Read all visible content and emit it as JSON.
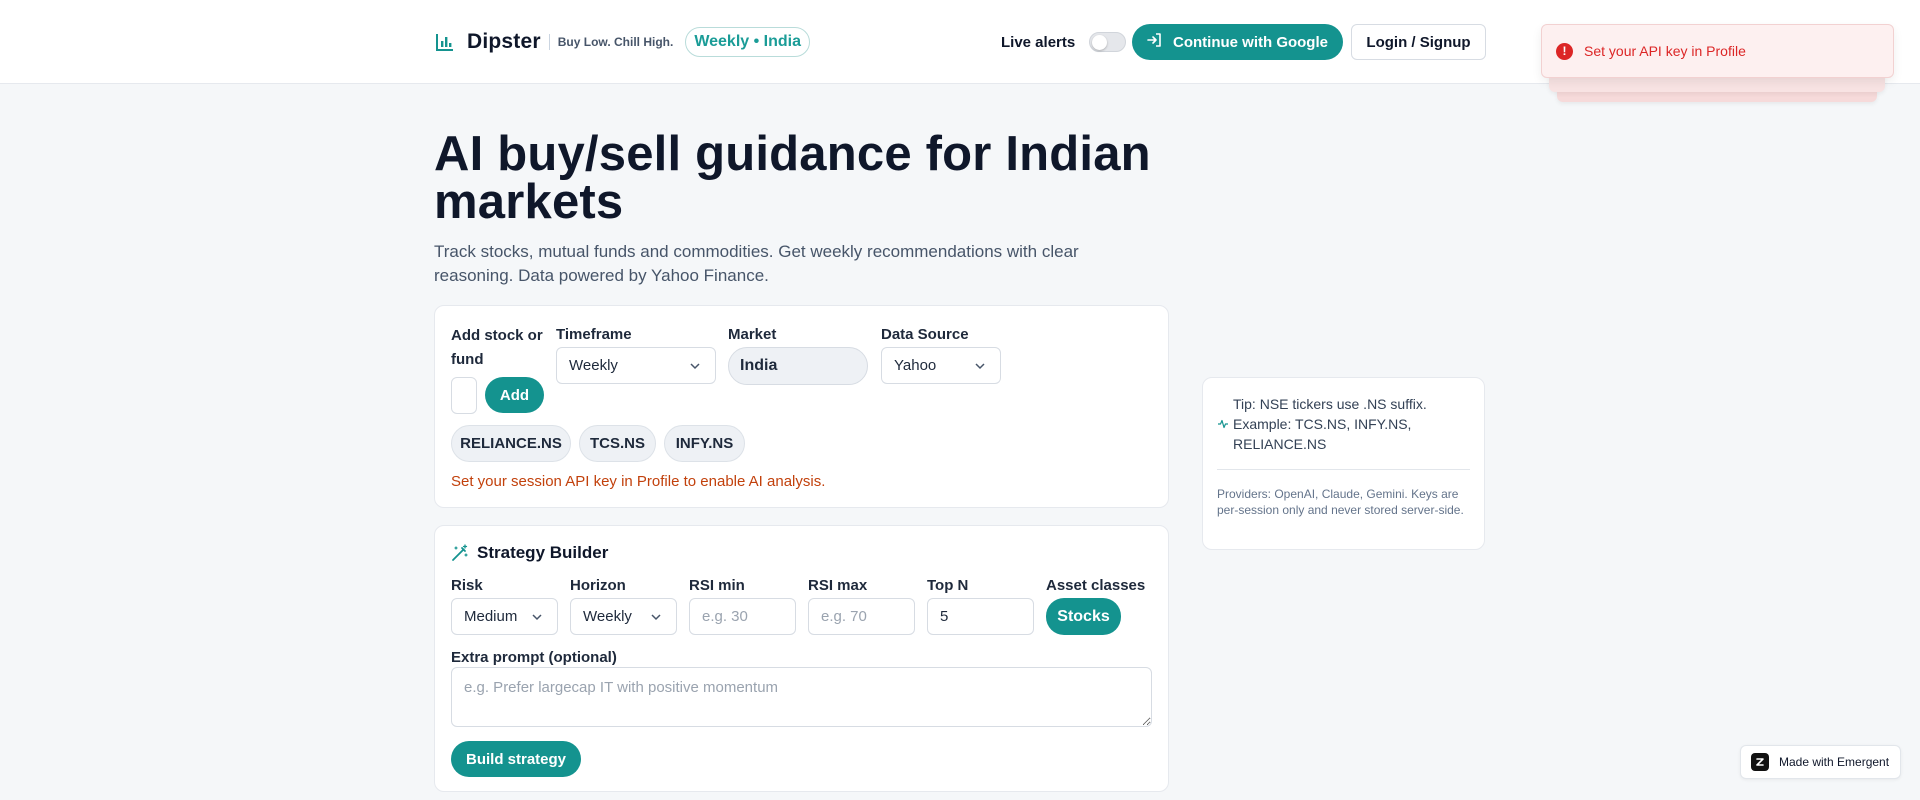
{
  "header": {
    "brand_name": "Dipster",
    "tagline": "Buy Low. Chill High.",
    "mode_badge": "Weekly • India",
    "live_alerts_label": "Live alerts",
    "live_alerts_enabled": false,
    "google_button": "Continue with Google",
    "login_button": "Login / Signup"
  },
  "toast": {
    "message": "Set your API key in Profile",
    "type": "error"
  },
  "hero": {
    "title": "AI buy/sell guidance for Indian markets",
    "subtitle": "Track stocks, mutual funds and commodities. Get weekly recommendations with clear reasoning. Data powered by Yahoo Finance."
  },
  "tracker": {
    "add_label": "Add stock or fund",
    "add_input_value": "",
    "add_button": "Add",
    "timeframe_label": "Timeframe",
    "timeframe_value": "Weekly",
    "market_label": "Market",
    "market_value": "India",
    "source_label": "Data Source",
    "source_value": "Yahoo",
    "tickers": [
      "RELIANCE.NS",
      "TCS.NS",
      "INFY.NS"
    ],
    "warning": "Set your session API key in Profile to enable AI analysis."
  },
  "strategy": {
    "title": "Strategy Builder",
    "risk_label": "Risk",
    "risk_value": "Medium",
    "horizon_label": "Horizon",
    "horizon_value": "Weekly",
    "rsi_min_label": "RSI min",
    "rsi_min_placeholder": "e.g. 30",
    "rsi_max_label": "RSI max",
    "rsi_max_placeholder": "e.g. 70",
    "topn_label": "Top N",
    "topn_value": "5",
    "asset_label": "Asset classes",
    "asset_value": "Stocks",
    "extra_label": "Extra prompt (optional)",
    "extra_placeholder": "e.g. Prefer largecap IT with positive momentum",
    "build_button": "Build strategy"
  },
  "tip": {
    "text": "Tip: NSE tickers use .NS suffix. Example: TCS.NS, INFY.NS, RELIANCE.NS",
    "footnote": "Providers: OpenAI, Claude, Gemini. Keys are per-session only and never stored server-side."
  },
  "badge": {
    "label": "Made with Emergent"
  },
  "colors": {
    "accent": "#14938f",
    "error": "#dc2626",
    "warning": "#c2410c"
  },
  "icons": [
    "chart-bars-icon",
    "sign-in-icon",
    "alert-circle-icon",
    "chevron-down-icon",
    "magic-wand-icon",
    "pulse-icon",
    "emergent-logo-icon"
  ]
}
